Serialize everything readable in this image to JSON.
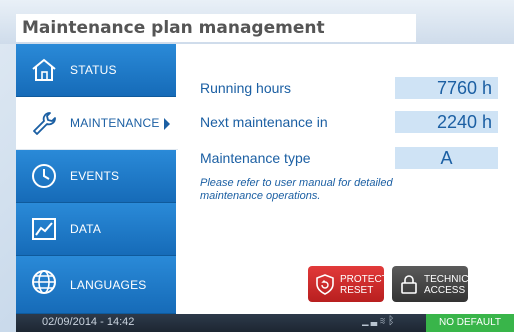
{
  "caption": {
    "title": "Maintenance plan management"
  },
  "nav": {
    "items": [
      {
        "label": "STATUS",
        "icon": "home-icon"
      },
      {
        "label": "MAINTENANCE",
        "icon": "wrench-icon",
        "active": true
      },
      {
        "label": "EVENTS",
        "icon": "clock-icon"
      },
      {
        "label": "DATA",
        "icon": "chart-icon"
      },
      {
        "label": "LANGUAGES",
        "icon": "globe-icon"
      }
    ]
  },
  "content": {
    "running_hours_label": "Running hours",
    "running_hours_value": "7760 h",
    "next_maintenance_label": "Next maintenance in",
    "next_maintenance_value": "2240 h",
    "maintenance_type_label": "Maintenance type",
    "maintenance_type_value": "A",
    "note": "Please refer to user manual for detailed maintenance operations."
  },
  "buttons": {
    "protection_reset": "PROTECTION RESET",
    "technician_access": "TECHNICIAN ACCESS"
  },
  "status_bar": {
    "datetime": "02/09/2014 - 14:42",
    "status": "NO DEFAULT"
  },
  "colors": {
    "accent": "#1b5fa3",
    "sidebar": "#1a73c2",
    "value_box": "#cfe3f5",
    "danger": "#d32f2f",
    "ok": "#39b54a"
  }
}
